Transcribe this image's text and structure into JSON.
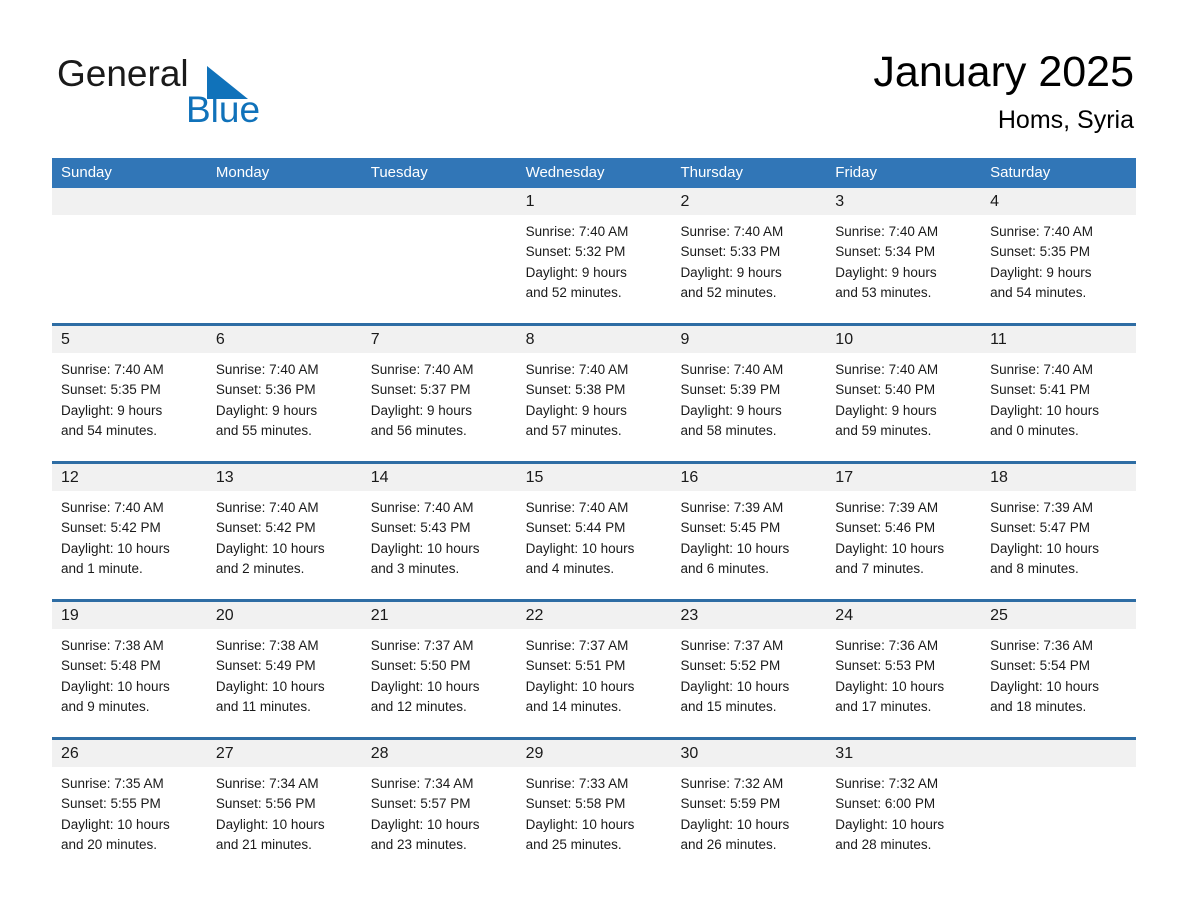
{
  "brand": {
    "name_part1": "General",
    "name_part2": "Blue",
    "triangle_icon": "blue-triangle-icon",
    "accent_color": "#1072ba"
  },
  "header": {
    "title": "January 2025",
    "subtitle": "Homs, Syria"
  },
  "colors": {
    "header_blue": "#3176b7",
    "row_border_blue": "#2e6da4",
    "day_band_gray": "#f1f1f1",
    "text": "#1a1a1a"
  },
  "weekdays": [
    "Sunday",
    "Monday",
    "Tuesday",
    "Wednesday",
    "Thursday",
    "Friday",
    "Saturday"
  ],
  "weeks": [
    [
      {
        "day": "",
        "lines": []
      },
      {
        "day": "",
        "lines": []
      },
      {
        "day": "",
        "lines": []
      },
      {
        "day": "1",
        "lines": [
          "Sunrise: 7:40 AM",
          "Sunset: 5:32 PM",
          "Daylight: 9 hours",
          "and 52 minutes."
        ]
      },
      {
        "day": "2",
        "lines": [
          "Sunrise: 7:40 AM",
          "Sunset: 5:33 PM",
          "Daylight: 9 hours",
          "and 52 minutes."
        ]
      },
      {
        "day": "3",
        "lines": [
          "Sunrise: 7:40 AM",
          "Sunset: 5:34 PM",
          "Daylight: 9 hours",
          "and 53 minutes."
        ]
      },
      {
        "day": "4",
        "lines": [
          "Sunrise: 7:40 AM",
          "Sunset: 5:35 PM",
          "Daylight: 9 hours",
          "and 54 minutes."
        ]
      }
    ],
    [
      {
        "day": "5",
        "lines": [
          "Sunrise: 7:40 AM",
          "Sunset: 5:35 PM",
          "Daylight: 9 hours",
          "and 54 minutes."
        ]
      },
      {
        "day": "6",
        "lines": [
          "Sunrise: 7:40 AM",
          "Sunset: 5:36 PM",
          "Daylight: 9 hours",
          "and 55 minutes."
        ]
      },
      {
        "day": "7",
        "lines": [
          "Sunrise: 7:40 AM",
          "Sunset: 5:37 PM",
          "Daylight: 9 hours",
          "and 56 minutes."
        ]
      },
      {
        "day": "8",
        "lines": [
          "Sunrise: 7:40 AM",
          "Sunset: 5:38 PM",
          "Daylight: 9 hours",
          "and 57 minutes."
        ]
      },
      {
        "day": "9",
        "lines": [
          "Sunrise: 7:40 AM",
          "Sunset: 5:39 PM",
          "Daylight: 9 hours",
          "and 58 minutes."
        ]
      },
      {
        "day": "10",
        "lines": [
          "Sunrise: 7:40 AM",
          "Sunset: 5:40 PM",
          "Daylight: 9 hours",
          "and 59 minutes."
        ]
      },
      {
        "day": "11",
        "lines": [
          "Sunrise: 7:40 AM",
          "Sunset: 5:41 PM",
          "Daylight: 10 hours",
          "and 0 minutes."
        ]
      }
    ],
    [
      {
        "day": "12",
        "lines": [
          "Sunrise: 7:40 AM",
          "Sunset: 5:42 PM",
          "Daylight: 10 hours",
          "and 1 minute."
        ]
      },
      {
        "day": "13",
        "lines": [
          "Sunrise: 7:40 AM",
          "Sunset: 5:42 PM",
          "Daylight: 10 hours",
          "and 2 minutes."
        ]
      },
      {
        "day": "14",
        "lines": [
          "Sunrise: 7:40 AM",
          "Sunset: 5:43 PM",
          "Daylight: 10 hours",
          "and 3 minutes."
        ]
      },
      {
        "day": "15",
        "lines": [
          "Sunrise: 7:40 AM",
          "Sunset: 5:44 PM",
          "Daylight: 10 hours",
          "and 4 minutes."
        ]
      },
      {
        "day": "16",
        "lines": [
          "Sunrise: 7:39 AM",
          "Sunset: 5:45 PM",
          "Daylight: 10 hours",
          "and 6 minutes."
        ]
      },
      {
        "day": "17",
        "lines": [
          "Sunrise: 7:39 AM",
          "Sunset: 5:46 PM",
          "Daylight: 10 hours",
          "and 7 minutes."
        ]
      },
      {
        "day": "18",
        "lines": [
          "Sunrise: 7:39 AM",
          "Sunset: 5:47 PM",
          "Daylight: 10 hours",
          "and 8 minutes."
        ]
      }
    ],
    [
      {
        "day": "19",
        "lines": [
          "Sunrise: 7:38 AM",
          "Sunset: 5:48 PM",
          "Daylight: 10 hours",
          "and 9 minutes."
        ]
      },
      {
        "day": "20",
        "lines": [
          "Sunrise: 7:38 AM",
          "Sunset: 5:49 PM",
          "Daylight: 10 hours",
          "and 11 minutes."
        ]
      },
      {
        "day": "21",
        "lines": [
          "Sunrise: 7:37 AM",
          "Sunset: 5:50 PM",
          "Daylight: 10 hours",
          "and 12 minutes."
        ]
      },
      {
        "day": "22",
        "lines": [
          "Sunrise: 7:37 AM",
          "Sunset: 5:51 PM",
          "Daylight: 10 hours",
          "and 14 minutes."
        ]
      },
      {
        "day": "23",
        "lines": [
          "Sunrise: 7:37 AM",
          "Sunset: 5:52 PM",
          "Daylight: 10 hours",
          "and 15 minutes."
        ]
      },
      {
        "day": "24",
        "lines": [
          "Sunrise: 7:36 AM",
          "Sunset: 5:53 PM",
          "Daylight: 10 hours",
          "and 17 minutes."
        ]
      },
      {
        "day": "25",
        "lines": [
          "Sunrise: 7:36 AM",
          "Sunset: 5:54 PM",
          "Daylight: 10 hours",
          "and 18 minutes."
        ]
      }
    ],
    [
      {
        "day": "26",
        "lines": [
          "Sunrise: 7:35 AM",
          "Sunset: 5:55 PM",
          "Daylight: 10 hours",
          "and 20 minutes."
        ]
      },
      {
        "day": "27",
        "lines": [
          "Sunrise: 7:34 AM",
          "Sunset: 5:56 PM",
          "Daylight: 10 hours",
          "and 21 minutes."
        ]
      },
      {
        "day": "28",
        "lines": [
          "Sunrise: 7:34 AM",
          "Sunset: 5:57 PM",
          "Daylight: 10 hours",
          "and 23 minutes."
        ]
      },
      {
        "day": "29",
        "lines": [
          "Sunrise: 7:33 AM",
          "Sunset: 5:58 PM",
          "Daylight: 10 hours",
          "and 25 minutes."
        ]
      },
      {
        "day": "30",
        "lines": [
          "Sunrise: 7:32 AM",
          "Sunset: 5:59 PM",
          "Daylight: 10 hours",
          "and 26 minutes."
        ]
      },
      {
        "day": "31",
        "lines": [
          "Sunrise: 7:32 AM",
          "Sunset: 6:00 PM",
          "Daylight: 10 hours",
          "and 28 minutes."
        ]
      },
      {
        "day": "",
        "lines": []
      }
    ]
  ]
}
